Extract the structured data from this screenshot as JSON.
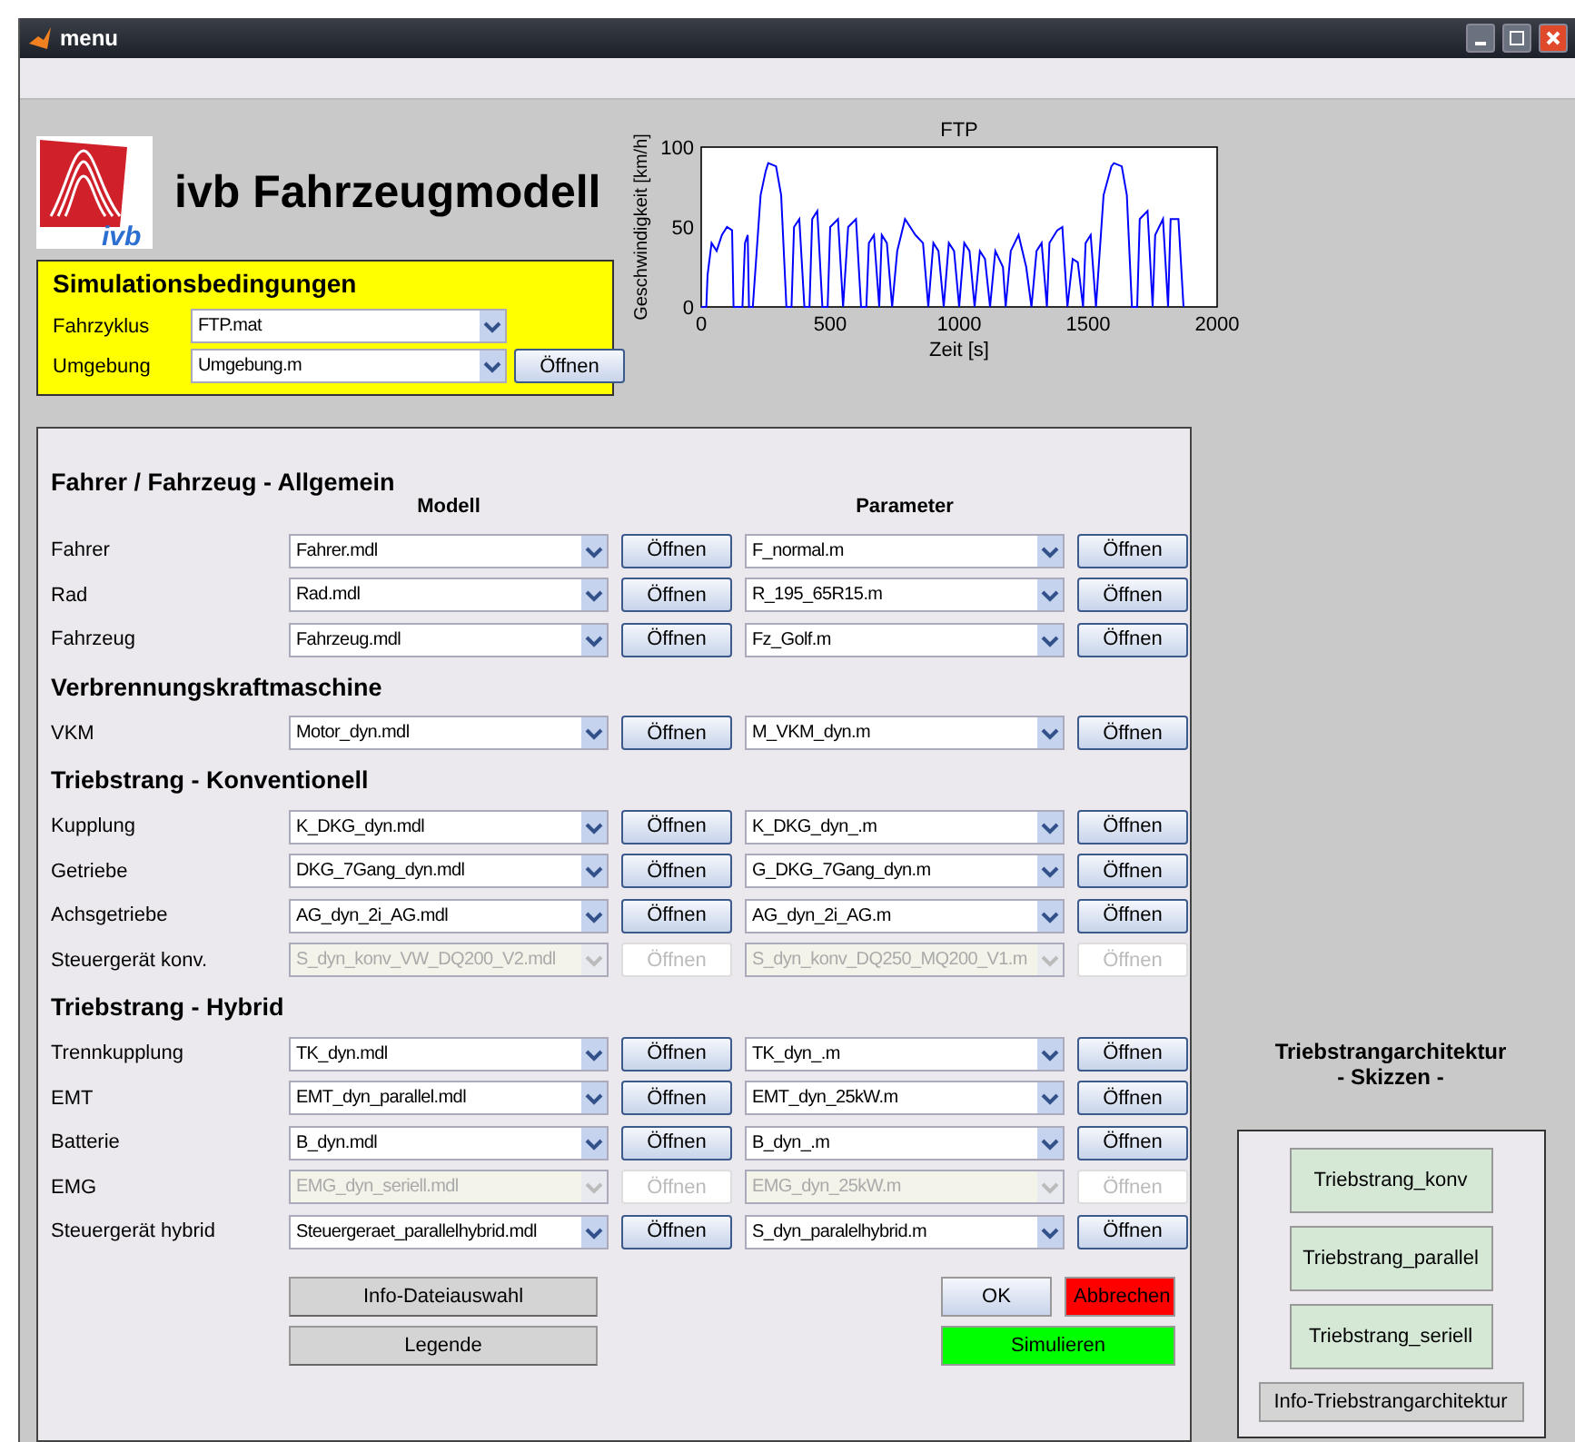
{
  "window": {
    "title": "menu"
  },
  "logo_text": "ivb",
  "app_title": "ivb Fahrzeugmodell",
  "conditions": {
    "title": "Simulationsbedingungen",
    "fields": [
      {
        "label": "Fahrzyklus",
        "value": "FTP.mat"
      },
      {
        "label": "Umgebung",
        "value": "Umgebung.m",
        "button": "Öffnen"
      }
    ]
  },
  "chart_data": {
    "type": "line",
    "title": "FTP",
    "xlabel": "Zeit [s]",
    "ylabel": "Geschwindigkeit [km/h]",
    "xlim": [
      0,
      2000
    ],
    "ylim": [
      0,
      100
    ],
    "xticks": [
      0,
      500,
      1000,
      1500,
      2000
    ],
    "yticks": [
      0,
      50,
      100
    ],
    "x": [
      0,
      20,
      25,
      40,
      60,
      80,
      100,
      120,
      125,
      160,
      170,
      180,
      185,
      200,
      230,
      250,
      260,
      290,
      310,
      330,
      350,
      360,
      380,
      400,
      420,
      430,
      450,
      470,
      490,
      500,
      530,
      550,
      570,
      600,
      620,
      640,
      650,
      670,
      690,
      700,
      720,
      740,
      760,
      790,
      830,
      860,
      880,
      900,
      920,
      940,
      960,
      980,
      1000,
      1020,
      1040,
      1060,
      1080,
      1100,
      1120,
      1140,
      1170,
      1180,
      1200,
      1230,
      1260,
      1280,
      1300,
      1320,
      1340,
      1350,
      1380,
      1400,
      1420,
      1440,
      1460,
      1480,
      1490,
      1510,
      1530,
      1560,
      1590,
      1600,
      1630,
      1650,
      1670,
      1690,
      1700,
      1730,
      1750,
      1760,
      1790,
      1810,
      1820,
      1850,
      1870
    ],
    "series": [
      {
        "color": "#0000ff",
        "values": [
          0,
          0,
          20,
          40,
          35,
          45,
          50,
          48,
          0,
          0,
          40,
          45,
          0,
          0,
          70,
          85,
          90,
          88,
          70,
          0,
          0,
          50,
          55,
          0,
          0,
          55,
          60,
          0,
          0,
          50,
          55,
          0,
          50,
          55,
          0,
          0,
          40,
          45,
          0,
          45,
          40,
          0,
          35,
          55,
          45,
          40,
          0,
          40,
          35,
          0,
          40,
          35,
          0,
          40,
          35,
          0,
          35,
          30,
          0,
          35,
          25,
          0,
          35,
          45,
          25,
          0,
          35,
          40,
          0,
          40,
          48,
          50,
          0,
          30,
          28,
          0,
          40,
          45,
          0,
          70,
          88,
          90,
          88,
          70,
          0,
          0,
          55,
          60,
          0,
          45,
          55,
          0,
          55,
          55,
          0
        ]
      }
    ]
  },
  "panel": {
    "model_header": "Modell",
    "parameter_header": "Parameter",
    "sections": [
      {
        "title": "Fahrer / Fahrzeug - Allgemein",
        "rows": [
          {
            "label": "Fahrer",
            "model": "Fahrer.mdl",
            "model_button": "Öffnen",
            "parameter": "F_normal.m",
            "parameter_button": "Öffnen",
            "enabled": true
          },
          {
            "label": "Rad",
            "model": "Rad.mdl",
            "model_button": "Öffnen",
            "parameter": "R_195_65R15.m",
            "parameter_button": "Öffnen",
            "enabled": true
          },
          {
            "label": "Fahrzeug",
            "model": "Fahrzeug.mdl",
            "model_button": "Öffnen",
            "parameter": "Fz_Golf.m",
            "parameter_button": "Öffnen",
            "enabled": true
          }
        ]
      },
      {
        "title": "Verbrennungskraftmaschine",
        "rows": [
          {
            "label": "VKM",
            "model": "Motor_dyn.mdl",
            "model_button": "Öffnen",
            "parameter": "M_VKM_dyn.m",
            "parameter_button": "Öffnen",
            "enabled": true
          }
        ]
      },
      {
        "title": "Triebstrang - Konventionell",
        "rows": [
          {
            "label": "Kupplung",
            "model": "K_DKG_dyn.mdl",
            "model_button": "Öffnen",
            "parameter": "K_DKG_dyn_.m",
            "parameter_button": "Öffnen",
            "enabled": true
          },
          {
            "label": "Getriebe",
            "model": "DKG_7Gang_dyn.mdl",
            "model_button": "Öffnen",
            "parameter": "G_DKG_7Gang_dyn.m",
            "parameter_button": "Öffnen",
            "enabled": true
          },
          {
            "label": "Achsgetriebe",
            "model": "AG_dyn_2i_AG.mdl",
            "model_button": "Öffnen",
            "parameter": "AG_dyn_2i_AG.m",
            "parameter_button": "Öffnen",
            "enabled": true
          },
          {
            "label": "Steuergerät konv.",
            "model": "S_dyn_konv_VW_DQ200_V2.mdl",
            "model_button": "Öffnen",
            "parameter": "S_dyn_konv_DQ250_MQ200_V1.m",
            "parameter_button": "Öffnen",
            "enabled": false
          }
        ]
      },
      {
        "title": "Triebstrang - Hybrid",
        "rows": [
          {
            "label": "Trennkupplung",
            "model": "TK_dyn.mdl",
            "model_button": "Öffnen",
            "parameter": "TK_dyn_.m",
            "parameter_button": "Öffnen",
            "enabled": true
          },
          {
            "label": "EMT",
            "model": "EMT_dyn_parallel.mdl",
            "model_button": "Öffnen",
            "parameter": "EMT_dyn_25kW.m",
            "parameter_button": "Öffnen",
            "enabled": true
          },
          {
            "label": "Batterie",
            "model": "B_dyn.mdl",
            "model_button": "Öffnen",
            "parameter": "B_dyn_.m",
            "parameter_button": "Öffnen",
            "enabled": true
          },
          {
            "label": "EMG",
            "model": "EMG_dyn_seriell.mdl",
            "model_button": "Öffnen",
            "parameter": "EMG_dyn_25kW.m",
            "parameter_button": "Öffnen",
            "enabled": false
          },
          {
            "label": "Steuergerät hybrid",
            "model": "Steuergeraet_parallelhybrid.mdl",
            "model_button": "Öffnen",
            "parameter": "S_dyn_paralelhybrid.m",
            "parameter_button": "Öffnen",
            "enabled": true
          }
        ]
      }
    ],
    "info_buttons": [
      "Info-Dateiauswahl",
      "Legende"
    ],
    "action_buttons": [
      {
        "label": "OK",
        "kind": "default"
      },
      {
        "label": "Abbrechen",
        "kind": "danger"
      },
      {
        "label": "Simulieren",
        "kind": "go"
      }
    ]
  },
  "sketches": {
    "title": "Triebstrangarchitektur",
    "subtitle": "- Skizzen -",
    "buttons": [
      {
        "label": "Triebstrang_konv",
        "kind": "sketch"
      },
      {
        "label": "Triebstrang_parallel",
        "kind": "sketch"
      },
      {
        "label": "Triebstrang_seriell",
        "kind": "sketch"
      },
      {
        "label": "Info-Triebstrangarchitektur",
        "kind": "info"
      }
    ]
  }
}
